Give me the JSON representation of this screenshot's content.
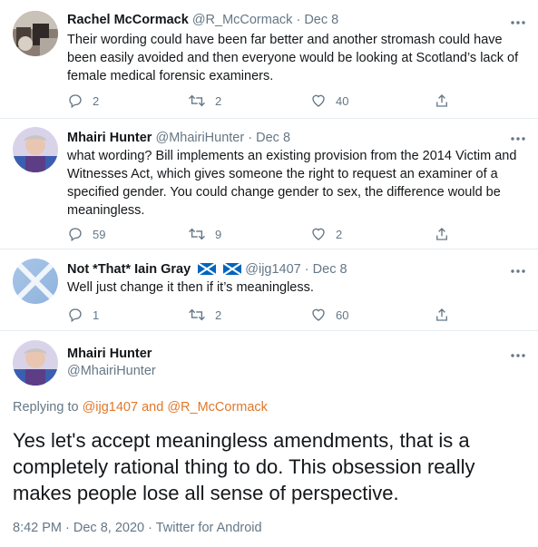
{
  "tweets": [
    {
      "name": "Rachel McCormack",
      "handle": "@R_McCormack",
      "sep": "·",
      "date": "Dec 8",
      "text": "Their wording could have been far better and another stromash could have been easily avoided and then everyone would be looking at Scotland’s lack of female medical forensic examiners.",
      "replies": "2",
      "retweets": "2",
      "likes": "40"
    },
    {
      "name": "Mhairi Hunter",
      "handle": "@MhairiHunter",
      "sep": "·",
      "date": "Dec 8",
      "text": "what wording? Bill implements an existing provision from the 2014 Victim and Witnesses Act, which gives someone the right to request an examiner of a specified gender. You could change gender to sex, the difference would be meaningless.",
      "replies": "59",
      "retweets": "9",
      "likes": "2"
    },
    {
      "name": "Not *That* Iain Gray",
      "handle": "@ijg1407",
      "sep": "·",
      "date": "Dec 8",
      "text": "Well just change it then if it’s meaningless.",
      "replies": "1",
      "retweets": "2",
      "likes": "60"
    }
  ],
  "main": {
    "name": "Mhairi Hunter",
    "handle": "@MhairiHunter",
    "replying_prefix": "Replying to",
    "replying_user1": "@ijg1407",
    "replying_and": "and",
    "replying_user2": "@R_McCormack",
    "text": "Yes let's accept meaningless amendments, that is a completely rational thing to do. This obsession really makes people lose all sense of perspective.",
    "meta": "8:42 PM · Dec 8, 2020 · Twitter for Android"
  },
  "icons": {
    "reply": "reply-icon",
    "retweet": "retweet-icon",
    "like": "heart-icon",
    "share": "share-icon",
    "more": "more-options-icon",
    "flag": "scotland-flag-icon"
  },
  "colors": {
    "text": "#14171a",
    "secondary": "#657786",
    "link": "#e0782a",
    "divider": "#e6ecf0",
    "flag": "#0065bd"
  }
}
